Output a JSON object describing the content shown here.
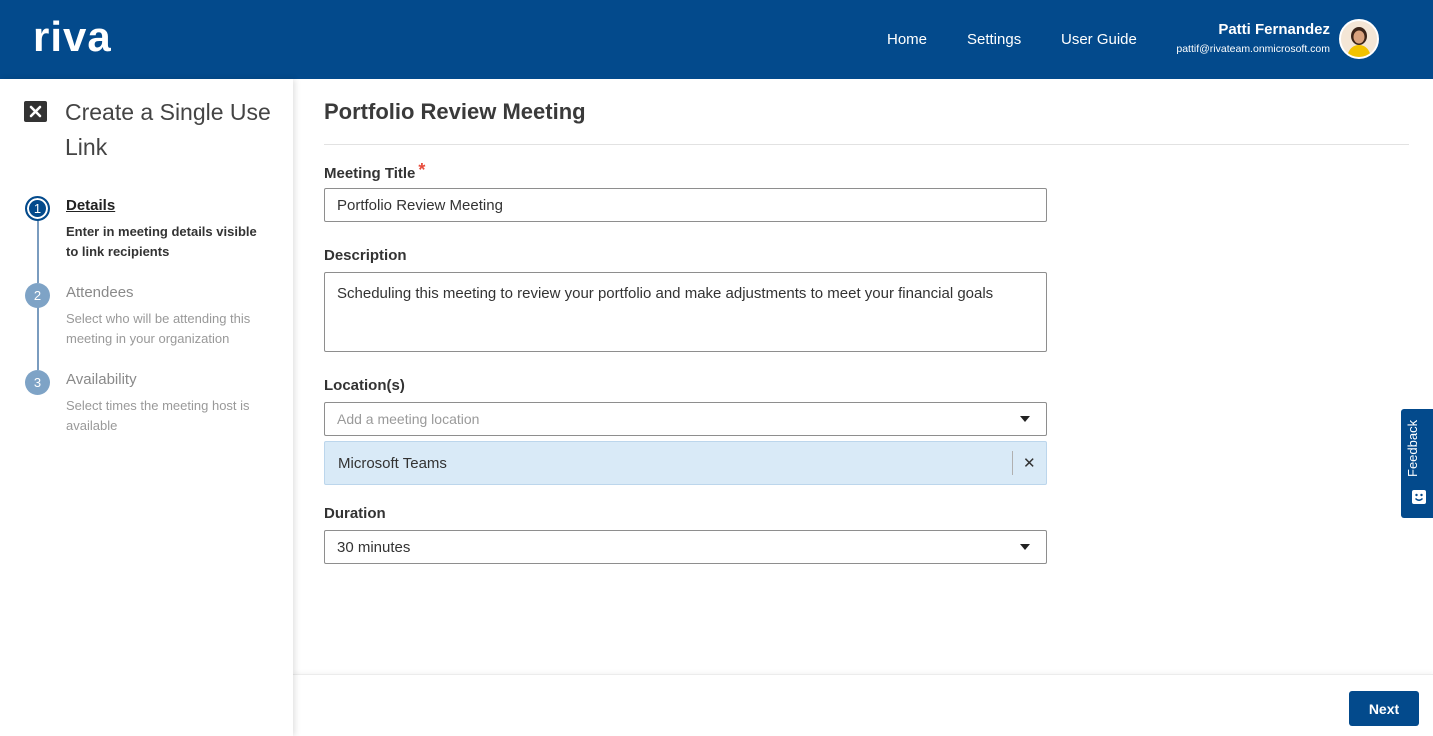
{
  "header": {
    "logo_text": "riva",
    "nav": [
      {
        "label": "Home"
      },
      {
        "label": "Settings"
      },
      {
        "label": "User Guide"
      }
    ],
    "user": {
      "name": "Patti Fernandez",
      "email": "pattif@rivateam.onmicrosoft.com"
    }
  },
  "sidebar": {
    "title": "Create a Single Use Link",
    "steps": [
      {
        "number": "1",
        "label": "Details",
        "description": "Enter in meeting details visible to link recipients",
        "state": "active"
      },
      {
        "number": "2",
        "label": "Attendees",
        "description": "Select who will be attending this meeting in your organization",
        "state": "inactive"
      },
      {
        "number": "3",
        "label": "Availability",
        "description": "Select times the meeting host is available",
        "state": "inactive"
      }
    ]
  },
  "main": {
    "page_title": "Portfolio Review Meeting",
    "meeting_title": {
      "label": "Meeting Title",
      "required_mark": "*",
      "value": "Portfolio Review Meeting"
    },
    "description": {
      "label": "Description",
      "value": "Scheduling this meeting to review your portfolio and make adjustments to meet your financial goals"
    },
    "location": {
      "label": "Location(s)",
      "placeholder": "Add a meeting location",
      "selected": [
        "Microsoft Teams"
      ],
      "remove_glyph": "✕"
    },
    "duration": {
      "label": "Duration",
      "value": "30 minutes"
    }
  },
  "footer": {
    "next_label": "Next"
  },
  "feedback": {
    "label": "Feedback"
  },
  "colors": {
    "brand": "#034a8c",
    "chip_bg": "#d9eaf7",
    "required": "#e74c3c"
  }
}
